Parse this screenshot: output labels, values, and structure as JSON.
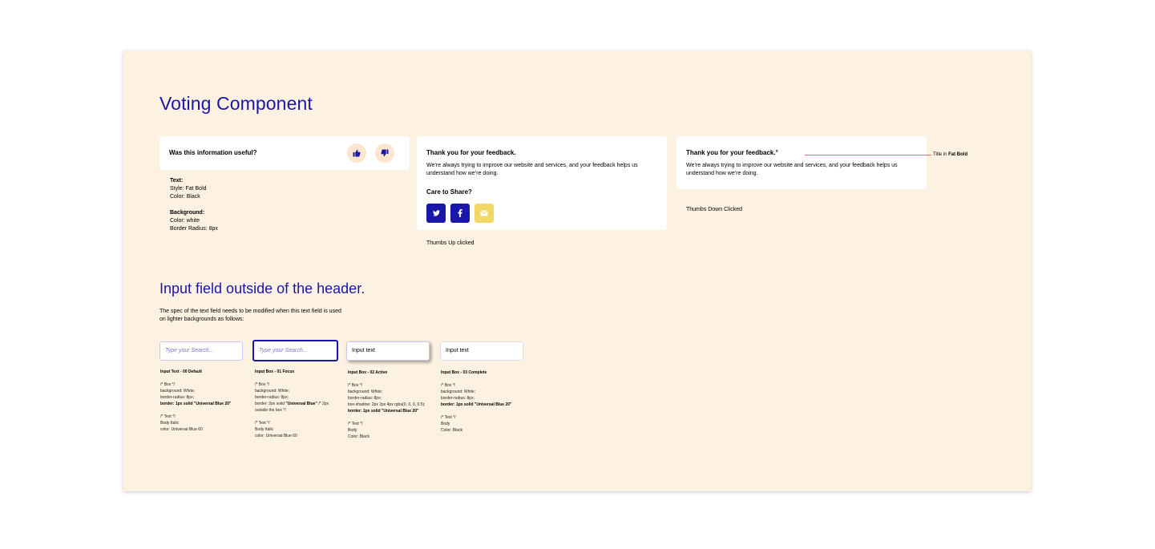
{
  "voting": {
    "title": "Voting Component",
    "question_card": {
      "question": "Was this information useful?"
    },
    "spec": {
      "text_heading": "Text:",
      "text_style": "Style: Fat Bold",
      "text_color": "Color: Black",
      "bg_heading": "Background:",
      "bg_color": "Color: white",
      "bg_radius": "Border Radius: 8px"
    },
    "thumbs_up_card": {
      "title": "Thank you for your feedback.",
      "body_line1": "We’re always trying to improve our website and services, and your feedback helps us",
      "body_line2": "understand how we’re doing.",
      "share_heading": "Care to Share?",
      "caption": "Thumbs Up clicked",
      "share_colors": {
        "twitter": "#1a17a8",
        "facebook": "#1a17a8",
        "email": "#f0d766"
      }
    },
    "thumbs_down_card": {
      "title": "Thank you for your feedback.°",
      "body_line1": "We’re always trying to improve our website and services, and your feedback helps us",
      "body_line2": "understand how we’re doing.",
      "caption": "Thumbs Down Clicked",
      "annotation_prefix": "Title in",
      "annotation_bold": "Fat Bold"
    }
  },
  "input_section": {
    "title": "Input field outside of the header.",
    "desc_line1": "The spec of the text field needs to be modified when this text field is used",
    "desc_line2": "on lighter backgrounds as follows:",
    "states": [
      {
        "placeholder": "Type your Search...",
        "label": "Input Text - 00 Default",
        "box_comment": "/* Box */",
        "bg": "background: White;",
        "radius": "border-radius: 8px;",
        "border": "border: 1px solid \"Universal Blue 20\"",
        "text_comment": "/* Text */",
        "font": "Body Italic",
        "color": "color: Universal Blue 60"
      },
      {
        "placeholder": "Type your Search...",
        "label": "Input Box - 01 Focus",
        "box_comment": "/* Box */",
        "bg": "background: White;",
        "radius": "border-radius: 8px;",
        "border_a": "border: 2px solid ",
        "border_b": "\"Universal Blue\"",
        "border_c": " /* 2px",
        "border_d": "outside the box */",
        "text_comment": "/* Text */",
        "font": "Body Italic",
        "color": "color: Universal Blue 60"
      },
      {
        "value": "Input text",
        "label": "Input Box - 02 Active",
        "box_comment": "/* Box */",
        "bg": "background: White;",
        "radius": "border-radius: 8px;",
        "shadow": "box-shadow: 2px 2px 4px rgba(0, 0, 0, 0.5);",
        "border": "border: 1px solid \"Universal Blue 20\"",
        "text_comment": "/* Text */",
        "font": "Body",
        "color": "Color: Black"
      },
      {
        "value": "Input text",
        "label": "Input Box - 03 Complete",
        "box_comment": "/* Box */",
        "bg": "background: White;",
        "radius": "border-radius: 8px;",
        "border": "border: 1px solid \"Universal Blue 20\"",
        "text_comment": "/* Text */",
        "font": "Body",
        "color": "Color: Black"
      }
    ]
  },
  "colors": {
    "brand_blue": "#1a17a8",
    "artboard_bg": "#fdf2e1",
    "annotation_line": "#e06b86"
  }
}
